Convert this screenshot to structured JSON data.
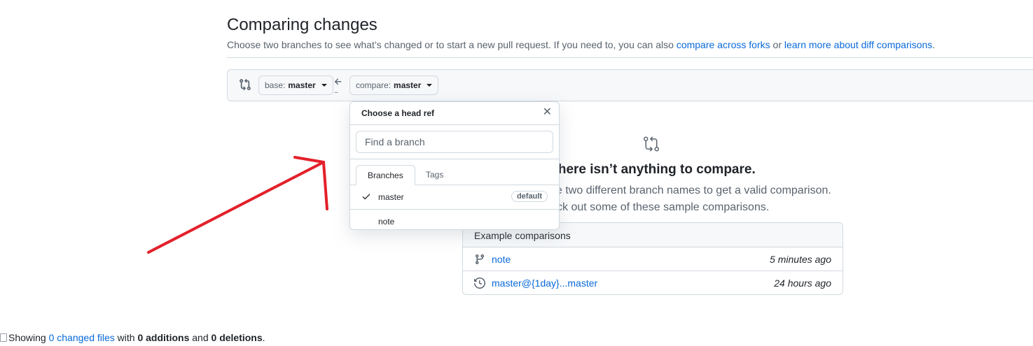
{
  "header": {
    "title": "Comparing changes",
    "subtitle_prefix": "Choose two branches to see what’s changed or to start a new pull request. If you need to, you can also ",
    "compare_forks_link": "compare across forks",
    "subtitle_or": " or ",
    "learn_more_link": "learn more about diff comparisons",
    "subtitle_end": "."
  },
  "range": {
    "base_prefix": "base:",
    "base_branch": "master",
    "compare_prefix": "compare:",
    "compare_branch": "master",
    "separator_dots": "..."
  },
  "popover": {
    "title": "Choose a head ref",
    "close_glyph": "✕",
    "filter_placeholder": "Find a branch",
    "filter_value": "",
    "tabs": [
      {
        "label": "Branches",
        "selected": true
      },
      {
        "label": "Tags",
        "selected": false
      }
    ],
    "items": [
      {
        "name": "master",
        "selected": true,
        "badge": "default"
      },
      {
        "name": "note",
        "selected": false,
        "badge": ""
      }
    ]
  },
  "blankslate": {
    "title": "There isn’t anything to compare.",
    "line1": "You’ll need to use two different branch names to get a valid comparison.",
    "line2": "Check out some of these sample comparisons."
  },
  "examples": {
    "header": "Example comparisons",
    "rows": [
      {
        "icon": "git-branch-icon",
        "label": "note",
        "time": "5 minutes ago"
      },
      {
        "icon": "history-icon",
        "label": "master@{1day}...master",
        "time": "24 hours ago"
      }
    ]
  },
  "toc": {
    "prefix": "Showing ",
    "files_link": "0 changed files",
    "with": " with ",
    "additions": "0 additions",
    "and": " and ",
    "deletions": "0 deletions",
    "end": "."
  },
  "colors": {
    "link": "#0969da",
    "annotation_arrow": "#e3202a",
    "muted": "#59636e"
  }
}
